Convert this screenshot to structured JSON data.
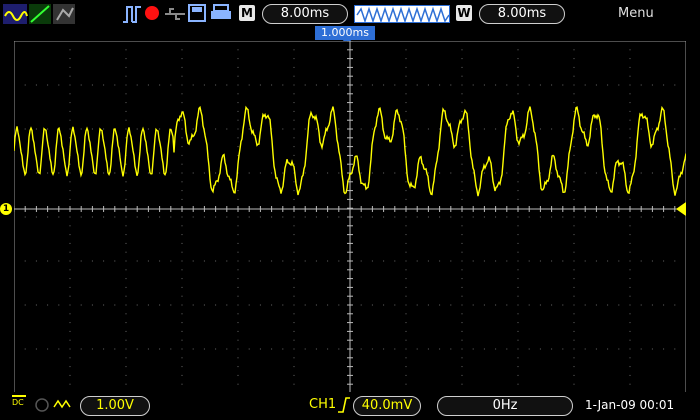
{
  "top": {
    "mem_depth_label": "M",
    "mem_depth_value": "8.00ms",
    "window_label": "W",
    "window_value": "8.00ms",
    "menu_label": "Menu"
  },
  "timebase": {
    "position_label": "1.000ms"
  },
  "channel": {
    "marker": "1"
  },
  "bottom": {
    "coupling": "DC",
    "ch1_volts": "1.00V",
    "trigger_channel": "CH1",
    "trigger_level": "40.0mV",
    "frequency": "0Hz",
    "datetime": "1-Jan-09 00:01"
  },
  "colors": {
    "trace": "#ffff00",
    "accent": "#2e6fd6",
    "grid": "#6a6a6a"
  }
}
